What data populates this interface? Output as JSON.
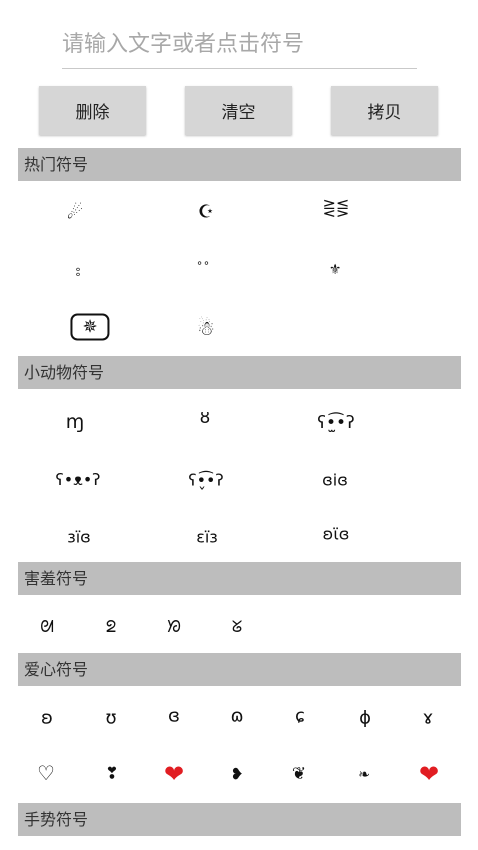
{
  "input": {
    "placeholder": "请输入文字或者点击符号",
    "value": ""
  },
  "buttons": {
    "delete": "删除",
    "clear": "清空",
    "copy": "拷贝"
  },
  "sections": {
    "hot": "热门符号",
    "animal": "小动物符号",
    "shy": "害羞符号",
    "love": "爱心符号",
    "gesture": "手势符号"
  },
  "hot_symbols": [
    "☄",
    "☪",
    "⋛⋚",
    "⦂",
    "∘∘",
    "⚜",
    "✵",
    "☃"
  ],
  "animal_symbols": [
    "ɱ",
    "ȣ",
    "ʕ•̫͡•ʔ",
    "ʕ•ᴥ•ʔ",
    "ʕ•̬͡•ʔ",
    "ɞiɞ",
    "ɜïɞ",
    "ɛïɜ",
    "ʚϊɞ"
  ],
  "shy_symbols": [
    "ᘛ",
    "ᘖ",
    "ᘞ",
    "ᘜ"
  ],
  "love_symbols_row1": [
    "ʚ",
    "ʊ",
    "ɞ",
    "ɷ",
    "ɕ",
    "ɸ",
    "ɤ"
  ],
  "love_symbols_row2": [
    "♡",
    "❣",
    "❤",
    "❥",
    "❦",
    "❧",
    "❤"
  ],
  "colors": {
    "header_bg": "#bdbdbd",
    "button_bg": "#d6d6d6",
    "heart_red": "#e11d22"
  }
}
